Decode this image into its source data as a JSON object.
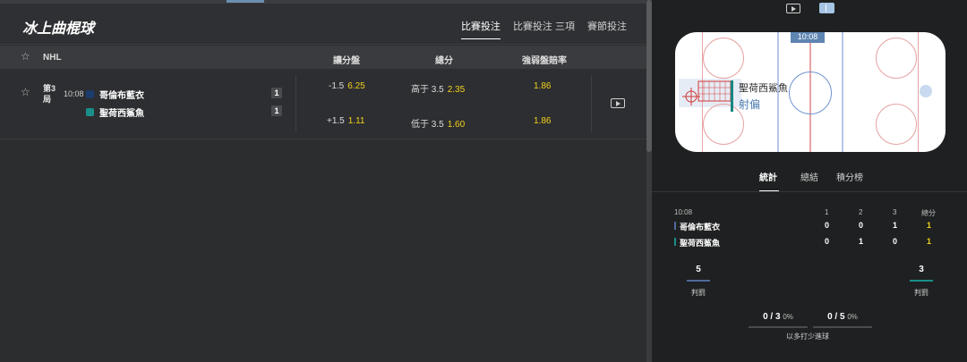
{
  "header": {
    "title": "冰上曲棍球",
    "tabs": [
      "比賽投注",
      "比賽投注 三項",
      "賽節投注"
    ]
  },
  "columns": {
    "league": "NHL",
    "handicap": "讓分盤",
    "total": "總分",
    "moneyline": "強弱盤賠率"
  },
  "match": {
    "period": "第3局",
    "time": "10:08",
    "team1": {
      "name": "哥倫布藍衣",
      "score": "1"
    },
    "team2": {
      "name": "聖荷西鯊魚",
      "score": "1"
    },
    "handicap": [
      {
        "line": "-1.5",
        "odd": "6.25"
      },
      {
        "line": "+1.5",
        "odd": "1.11"
      }
    ],
    "total": [
      {
        "line": "高于 3.5",
        "odd": "2.35"
      },
      {
        "line": "低于 3.5",
        "odd": "1.60"
      }
    ],
    "moneyline": [
      "1.86",
      "1.86"
    ]
  },
  "rink": {
    "clock": "10:08",
    "event_team": "聖荷西鯊魚",
    "event_action": "射偏"
  },
  "stats_tabs": [
    "統計",
    "總結",
    "積分榜"
  ],
  "stats": {
    "time": "10:08",
    "period_headers": [
      "1",
      "2",
      "3"
    ],
    "total_header": "總分",
    "rows": [
      {
        "team": "哥倫布藍衣",
        "p": [
          "0",
          "0",
          "1"
        ],
        "total": "1"
      },
      {
        "team": "聖荷西鯊魚",
        "p": [
          "0",
          "1",
          "0"
        ],
        "total": "1"
      }
    ]
  },
  "penalties": {
    "home": "5",
    "away": "3",
    "label": "判罰"
  },
  "powerplay": {
    "home": {
      "value": "0 / 3",
      "pct": "0%"
    },
    "away": {
      "value": "0 / 5",
      "pct": "0%"
    },
    "label": "以多打少進球"
  },
  "colors": {
    "accent_yellow": "#f2d21b",
    "team1": "#1c3c6d",
    "team2": "#1a8f8a",
    "clock": "#5f85b2"
  }
}
